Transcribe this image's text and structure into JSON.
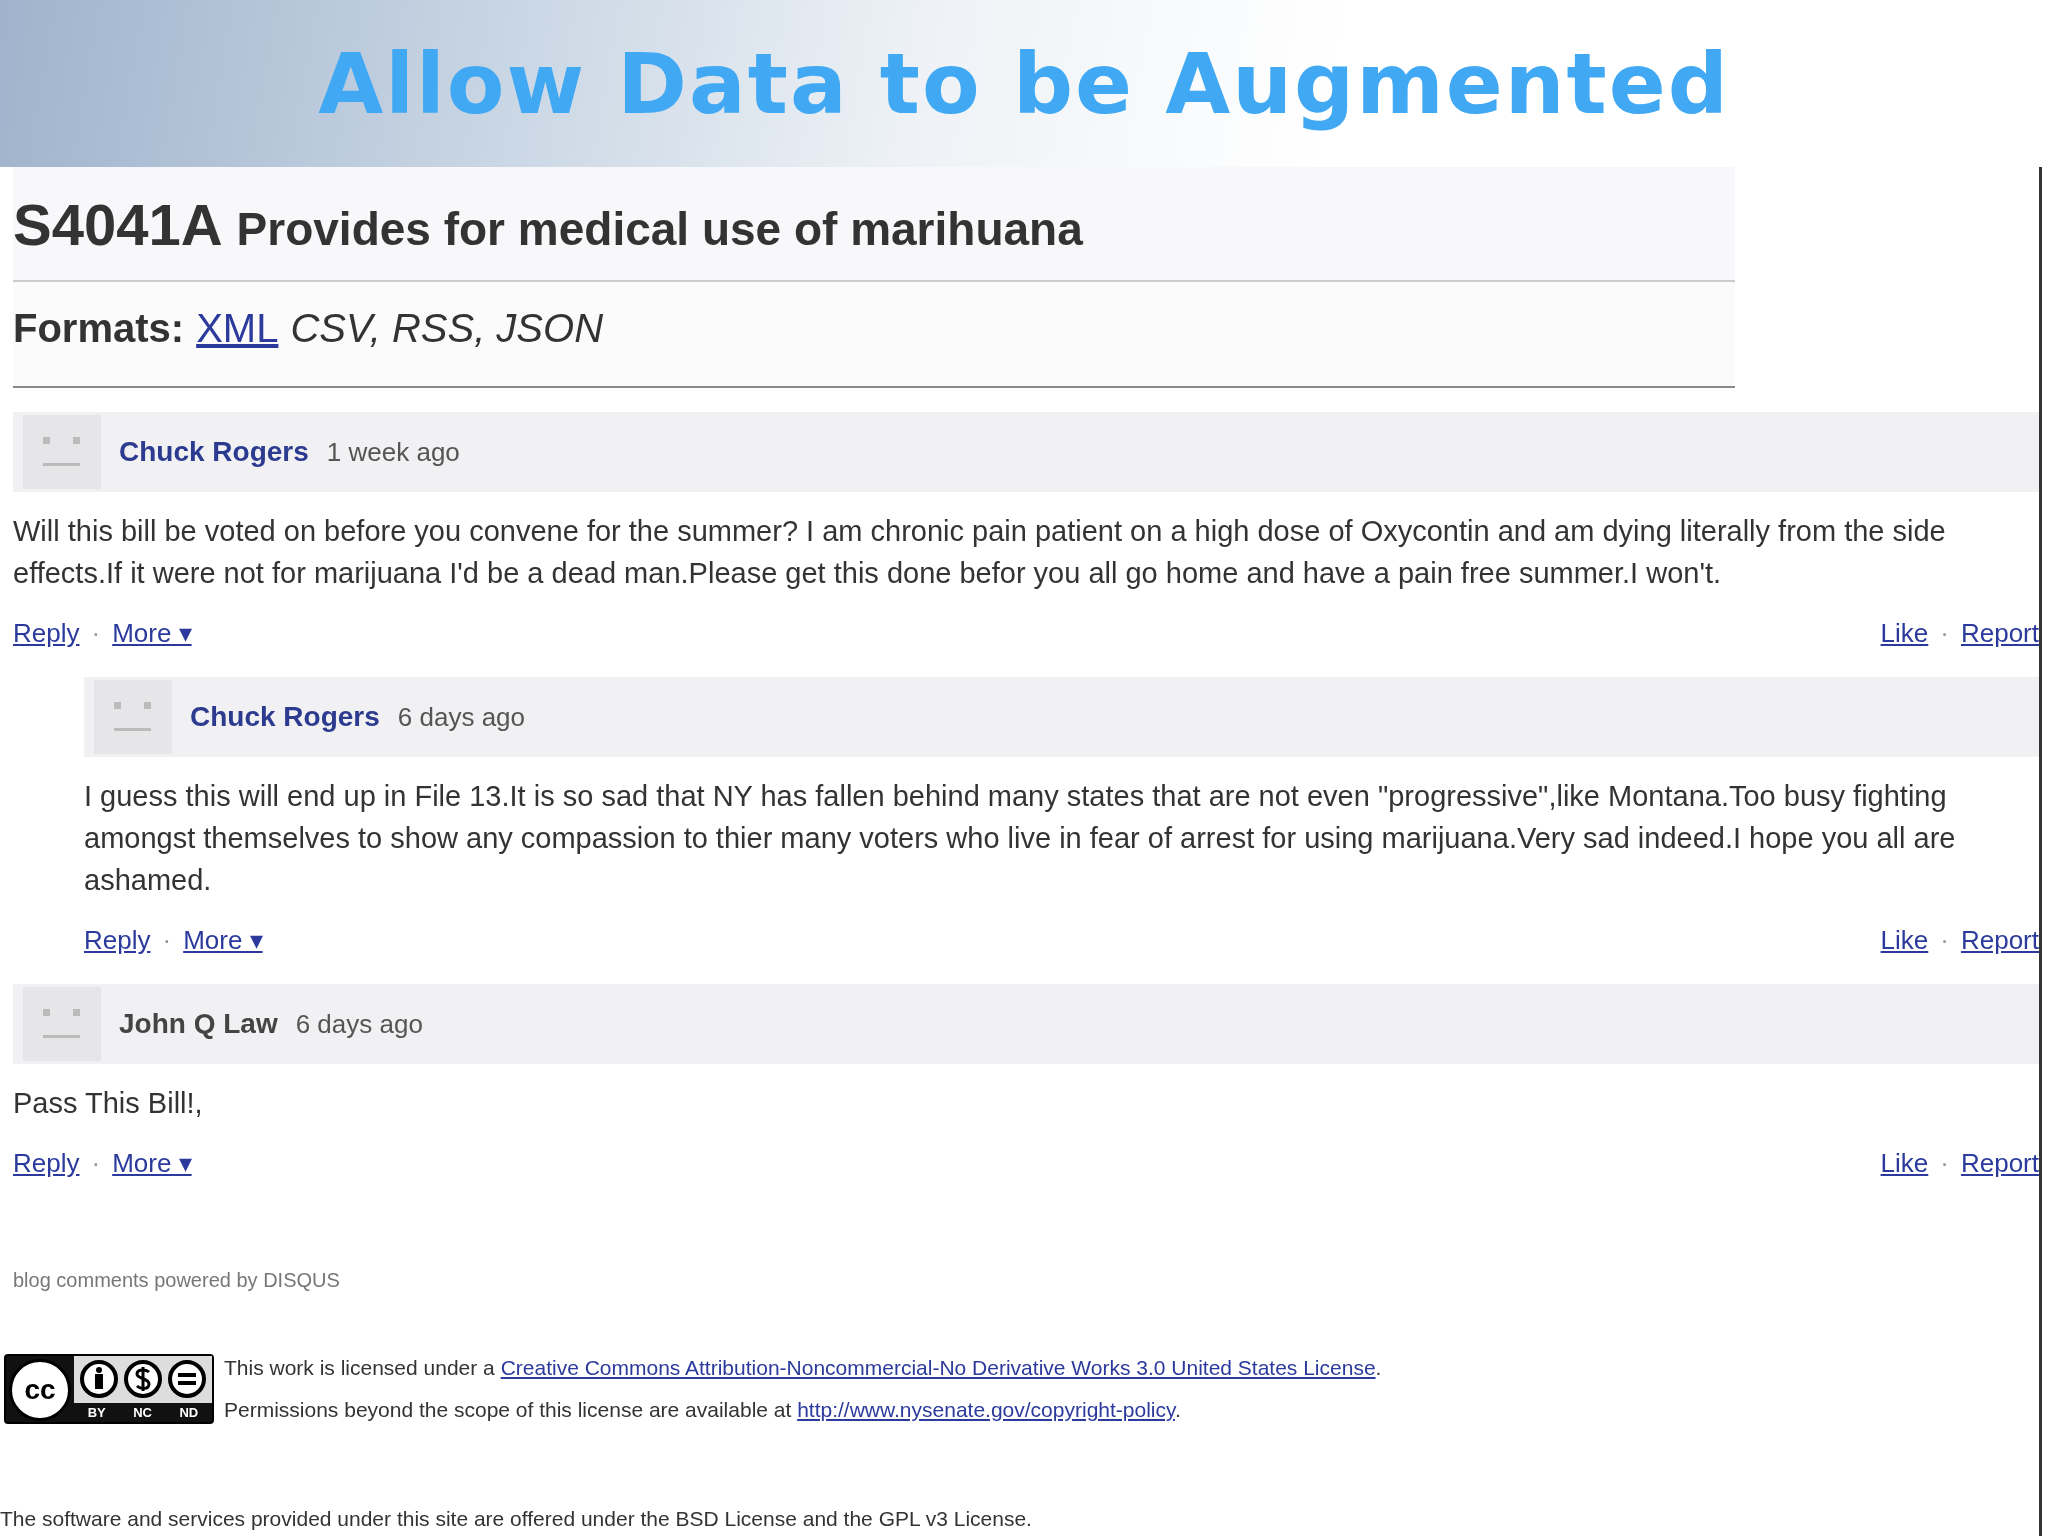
{
  "slide_title": "Allow Data to be Augmented",
  "bill": {
    "number": "S4041A",
    "title": "Provides for medical use of marihuana"
  },
  "formats": {
    "label": "Formats:",
    "link": "XML",
    "others": "CSV, RSS, JSON"
  },
  "comments": [
    {
      "author": "Chuck Rogers",
      "author_linked": true,
      "time": "1 week ago",
      "action_separator": "·",
      "text": "Will this bill be voted on before you convene for the summer? I am chronic pain patient on a high dose of Oxycontin and am dying literally from the side effects.If it were not for marijuana I'd be a dead man.Please get this done befor you all go home and have a pain free summer.I won't.",
      "actions_left": [
        "Reply",
        "More ▾"
      ],
      "actions_right": [
        "Like",
        "Report"
      ],
      "children": [
        {
          "author": "Chuck Rogers",
          "author_linked": true,
          "time": "6 days ago",
          "action_separator": "·",
          "text": "I guess this will end up in File 13.It is so sad that NY has fallen behind many states that are not even \"progressive\",like Montana.Too busy fighting amongst themselves to show any compassion to thier many voters who live in fear of arrest for using marijuana.Very sad indeed.I hope you all are ashamed.",
          "actions_left": [
            "Reply",
            "More ▾"
          ],
          "actions_right": [
            "Like",
            "Report"
          ]
        }
      ]
    },
    {
      "author": "John Q Law",
      "author_linked": false,
      "time": "6 days ago",
      "action_separator": "·",
      "text": "Pass This Bill!,",
      "actions_left": [
        "Reply",
        "More ▾"
      ],
      "actions_right": [
        "Like",
        "Report"
      ]
    }
  ],
  "powered_by": "blog comments powered by DISQUS",
  "license": {
    "badge_logo": "cc",
    "badge_labels": [
      "BY",
      "NC",
      "ND"
    ],
    "line_1_text": "This work is licensed under a ",
    "line_1_link": "Creative Commons Attribution-Noncommercial-No Derivative Works 3.0 United States License",
    "line_1_end": ".",
    "line_2_text": "Permissions beyond the scope of this license are available at ",
    "line_2_link": "http://www.nysenate.gov/copyright-policy",
    "line_2_end": "."
  },
  "software_notice": "The software and services provided under this site are offered under the BSD License and the GPL v3 License."
}
